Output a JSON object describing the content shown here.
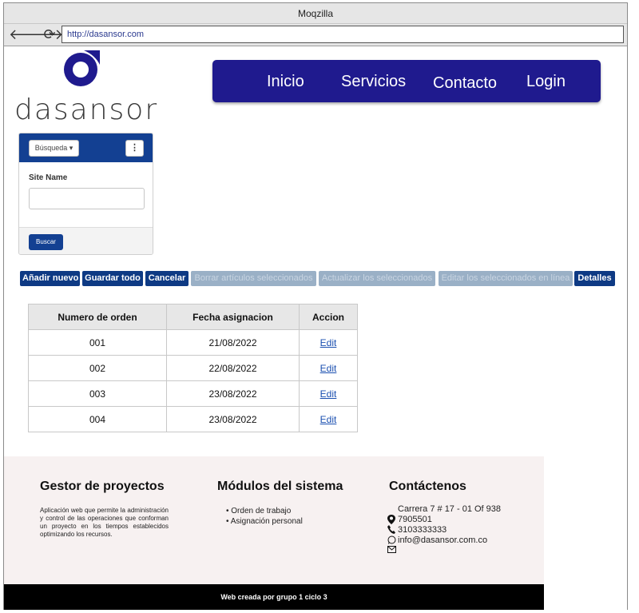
{
  "browser": {
    "title": "Moqzilla",
    "url": "http://dasansor.com",
    "back_glyph": "🡐",
    "forward_glyph": "🡒",
    "reload_glyph": "⟳"
  },
  "brand": {
    "name": "dasansor",
    "color": "#1f1a8e"
  },
  "nav": {
    "items": [
      {
        "label": "Inicio"
      },
      {
        "label": "Servicios"
      },
      {
        "label": "Contacto"
      },
      {
        "label": "Login"
      }
    ]
  },
  "search": {
    "dropdown_label": "Búsqueda ▾",
    "menu_glyph": "⋮",
    "field_label": "Site Name",
    "field_value": "",
    "submit_label": "Buscar"
  },
  "actions": [
    {
      "label": "Añadir nuevo",
      "enabled": true
    },
    {
      "label": "Guardar todo",
      "enabled": true
    },
    {
      "label": "Cancelar",
      "enabled": true
    },
    {
      "label": "Borrar artículos seleccionados",
      "enabled": false
    },
    {
      "label": "Actualizar los seleccionados",
      "enabled": false
    },
    {
      "label": "Editar los seleccionados en línea",
      "enabled": false
    },
    {
      "label": "Detalles",
      "enabled": true
    }
  ],
  "table": {
    "headers": [
      "Numero de orden",
      "Fecha asignacion",
      "Accion"
    ],
    "rows": [
      {
        "order": "001",
        "date": "21/08/2022",
        "action": "Edit"
      },
      {
        "order": "002",
        "date": "22/08/2022",
        "action": "Edit"
      },
      {
        "order": "003",
        "date": "23/08/2022",
        "action": "Edit"
      },
      {
        "order": "004",
        "date": "23/08/2022",
        "action": "Edit"
      }
    ]
  },
  "footer": {
    "about": {
      "title": "Gestor de proyectos",
      "text": "Aplicación web que permite la administración y control de las operaciones que conforman un proyecto en los tiempos establecidos optimizando los recursos."
    },
    "modules": {
      "title": "Módulos del sistema",
      "items": [
        "Orden de trabajo",
        "Asignación personal"
      ]
    },
    "contact": {
      "title": "Contáctenos",
      "address": "Carrera 7 # 17 - 01 Of 938",
      "phone1": "7905501",
      "phone2": "3103333333",
      "email": "info@dasansor.com.co"
    },
    "copyright": "Web creada por grupo 1 ciclo 3"
  }
}
